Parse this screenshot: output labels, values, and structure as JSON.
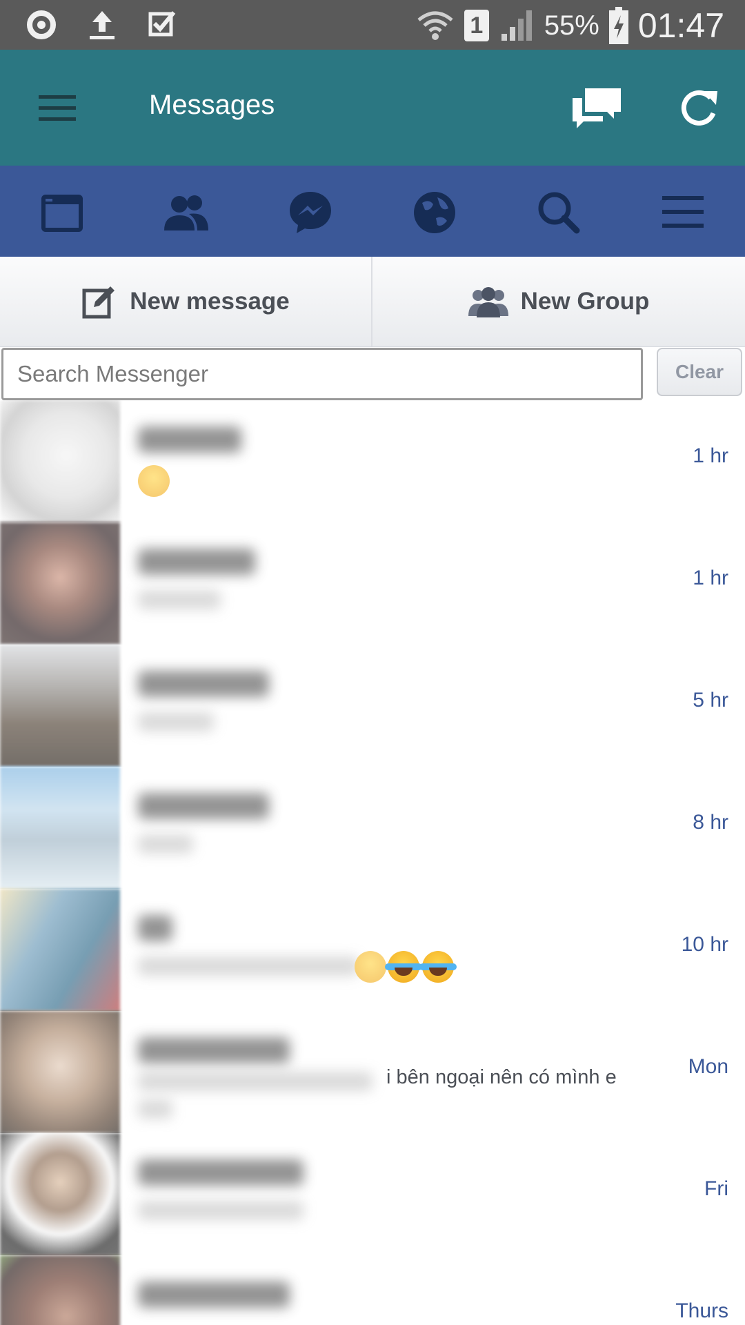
{
  "status_bar": {
    "battery_percent": "55%",
    "sim_slot": "1",
    "time": "01:47",
    "icons": [
      "sync-icon",
      "upload-icon",
      "task-check-icon",
      "wifi-icon",
      "signal-icon",
      "battery-charging-icon"
    ]
  },
  "header": {
    "title": "Messages",
    "icons": [
      "menu-icon",
      "chat-bubbles-icon",
      "refresh-icon"
    ],
    "background": "#2b7782"
  },
  "fb_nav": {
    "background": "#3b5898",
    "items": [
      "news-feed-icon",
      "friends-icon",
      "messenger-icon",
      "globe-notifications-icon",
      "search-icon",
      "more-menu-icon"
    ]
  },
  "actions": {
    "new_message": "New message",
    "new_group": "New Group"
  },
  "search": {
    "placeholder": "Search Messenger",
    "clear_label": "Clear"
  },
  "conversations": [
    {
      "time": "1 hr",
      "snippet_visible": "",
      "emoji": "sun-emoji"
    },
    {
      "time": "1 hr",
      "snippet_visible": ""
    },
    {
      "time": "5 hr",
      "snippet_visible": ""
    },
    {
      "time": "8 hr",
      "snippet_visible": ""
    },
    {
      "time": "10 hr",
      "snippet_visible": "",
      "emoji": "laughing-tears-emoji"
    },
    {
      "time": "Mon",
      "snippet_visible": "i bên ngoại nên có mình e"
    },
    {
      "time": "Fri",
      "snippet_visible": ""
    },
    {
      "time": "Thurs",
      "snippet_visible": ""
    }
  ],
  "colors": {
    "accent_blue": "#3b5898",
    "teal": "#2b7782",
    "time_text": "#3b5898"
  }
}
